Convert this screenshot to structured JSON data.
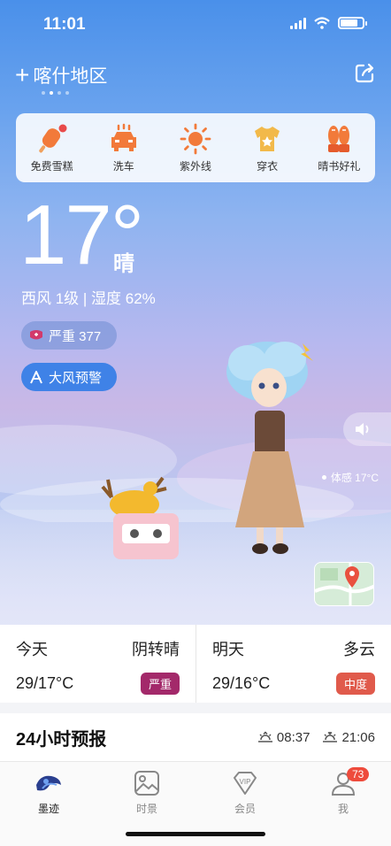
{
  "status": {
    "time": "11:01"
  },
  "header": {
    "location": "喀什地区"
  },
  "quick_items": [
    {
      "label": "免费雪糕",
      "icon": "popsicle-icon"
    },
    {
      "label": "洗车",
      "icon": "car-wash-icon"
    },
    {
      "label": "紫外线",
      "icon": "sun-icon"
    },
    {
      "label": "穿衣",
      "icon": "shirt-icon"
    },
    {
      "label": "晴书好礼",
      "icon": "gift-icon"
    }
  ],
  "current": {
    "temperature": "17°",
    "condition": "晴",
    "wind_humidity": "西风 1级 | 湿度 62%",
    "aqi": "严重 377",
    "warning": "大风预警",
    "feels_like": "体感 17°C"
  },
  "today": {
    "label": "今天",
    "condition": "阴转晴",
    "temps": "29/17°C",
    "aqi": "严重",
    "aqi_color": "#a3296a"
  },
  "tomorrow": {
    "label": "明天",
    "condition": "多云",
    "temps": "29/16°C",
    "aqi": "中度",
    "aqi_color": "#e05a4b"
  },
  "forecast": {
    "title": "24小时预报",
    "sunrise": "08:37",
    "sunset": "21:06"
  },
  "tabs": [
    {
      "label": "墨迹",
      "icon": "moji-logo-icon",
      "active": true
    },
    {
      "label": "时景",
      "icon": "photo-icon"
    },
    {
      "label": "会员",
      "icon": "vip-icon"
    },
    {
      "label": "我",
      "icon": "profile-icon",
      "badge": "73"
    }
  ]
}
